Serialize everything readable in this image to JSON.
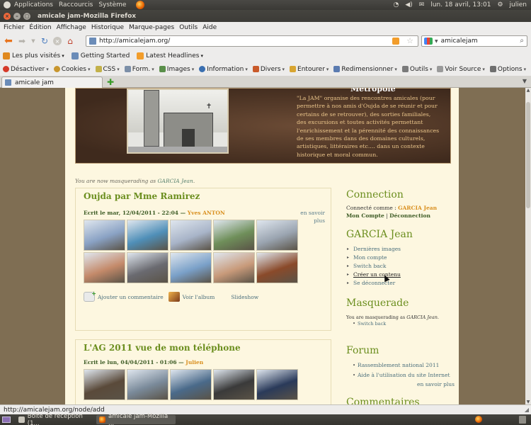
{
  "top_panel": {
    "menus": [
      "Applications",
      "Raccourcis",
      "Système"
    ],
    "clock": "lun. 18 avril, 13:01",
    "user": "julien"
  },
  "window": {
    "title": "amicale jam-Mozilla Firefox"
  },
  "menubar": [
    "Fichier",
    "Édition",
    "Affichage",
    "Historique",
    "Marque-pages",
    "Outils",
    "Aide"
  ],
  "navbar": {
    "url": "http://amicalejam.org/",
    "search_value": "amicalejam"
  },
  "bookmarks": [
    {
      "label": "Les plus visités",
      "color": "#e0891f"
    },
    {
      "label": "Getting Started",
      "color": "#6b8cb8"
    },
    {
      "label": "Latest Headlines",
      "color": "#f29d2b"
    }
  ],
  "devbar": [
    {
      "label": "Désactiver",
      "color": "#d53a2a"
    },
    {
      "label": "Cookies",
      "color": "#c8962e"
    },
    {
      "label": "CSS",
      "color": "#c3b14a"
    },
    {
      "label": "Form.",
      "color": "#7c8fa8"
    },
    {
      "label": "Images",
      "color": "#5a8f4a"
    },
    {
      "label": "Information",
      "color": "#3a6fb0"
    },
    {
      "label": "Divers",
      "color": "#c95a2a"
    },
    {
      "label": "Entourer",
      "color": "#d8a531"
    },
    {
      "label": "Redimensionner",
      "color": "#5b7bb0"
    },
    {
      "label": "Outils",
      "color": "#7a7a7a"
    },
    {
      "label": "Voir Source",
      "color": "#9a9a9a"
    },
    {
      "label": "Options",
      "color": "#6f6f6f"
    }
  ],
  "tab": {
    "title": "amicale jam"
  },
  "banner": {
    "heading": "Métropole",
    "text": "\"La JAM\" organise des rencontres amicales (pour permettre à nos amis d'Oujda de se réunir et pour certains de se retrouver), des sorties familiales, des excursions et toutes activités permettant l'enrichissement et la pérennité des connaissances de ses membres dans des domaines culturels, artistiques, littéraires etc.... dans un contexte historique et moral commun."
  },
  "masquerade_note": {
    "prefix": "You are now masquerading as ",
    "name": "GARCIA Jean",
    "suffix": "."
  },
  "articles": [
    {
      "title": "Oujda par Mme Ramirez",
      "meta_prefix": "Ecrit le mar, 12/04/2011 - 22:04 — ",
      "author": "Yves ANTON",
      "more": "en savoir plus",
      "thumb_colors": [
        "#8aa2c4",
        "#4f8fb8",
        "#a8b4c8",
        "#6f8f5a",
        "#9aa4b0",
        "#c48a6a",
        "#6a6a70",
        "#7aa0c8",
        "#c89a7a",
        "#8a4a2a"
      ],
      "actions": {
        "comment": "Ajouter un commentaire",
        "album": "Voir l'album",
        "slideshow": "Slideshow"
      }
    },
    {
      "title": "L'AG 2011 vue de mon téléphone",
      "meta_prefix": "Ecrit le lun, 04/04/2011 - 01:06 — ",
      "author": "Julien",
      "thumb_colors": [
        "#5a4a3a",
        "#7a8a9a",
        "#4a6a8a",
        "#3a3a3a",
        "#2a3a5a"
      ]
    }
  ],
  "sidebar": {
    "connection": {
      "title": "Connection",
      "connected_prefix": "Connecté comme : ",
      "user": "GARCIA Jean",
      "account": "Mon Compte",
      "separator": " | ",
      "logout": "Déconnection"
    },
    "user_block": {
      "title": "GARCIA Jean",
      "items": [
        "Dernières images",
        "Mon compte",
        "Switch back",
        "Créer un contenu",
        "Se déconnecter"
      ]
    },
    "masquerade": {
      "title": "Masquerade",
      "text_prefix": "You are masquerading as ",
      "user": "GARCIA Jean",
      "text_suffix": ".",
      "link": "Switch back"
    },
    "forum": {
      "title": "Forum",
      "items": [
        "Rassemblement national 2011",
        "Aide à l'utilisation du site Internet"
      ],
      "more": "en savoir plus"
    },
    "comments": {
      "title": "Commentaires"
    }
  },
  "statusbar": {
    "text": "http://amicalejam.org/node/add"
  },
  "taskbar": {
    "tasks": [
      "Boîte de réception (1...",
      "amicale jam-Mozilla ..."
    ]
  }
}
